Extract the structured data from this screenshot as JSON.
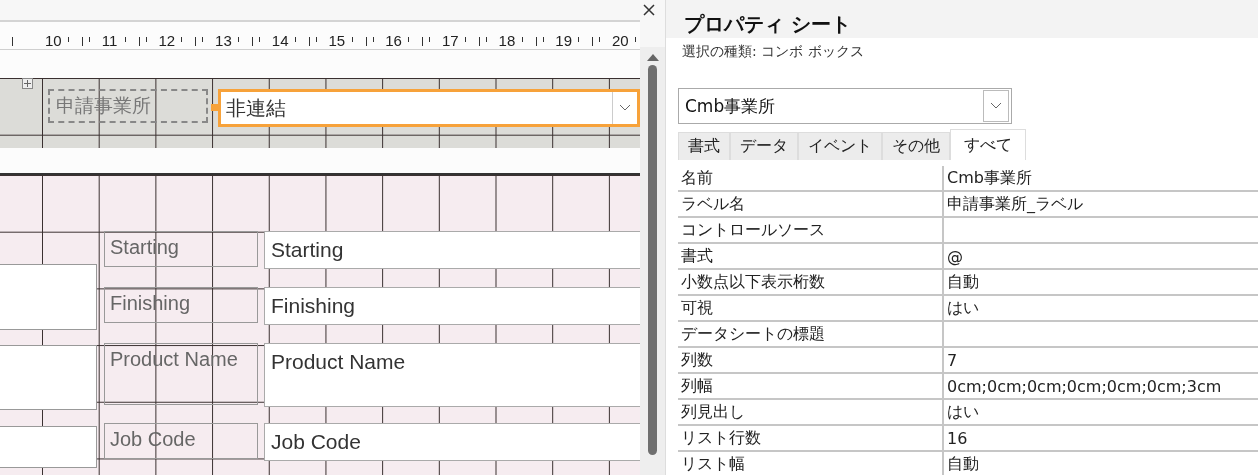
{
  "designer": {
    "ruler": [
      "10",
      "11",
      "12",
      "13",
      "14",
      "15",
      "16",
      "17",
      "18",
      "19",
      "20"
    ],
    "header": {
      "label": "申請事業所",
      "combo": {
        "value": "非連結",
        "selected": true
      }
    },
    "detail": [
      {
        "label": "Starting",
        "textbox": "Starting",
        "tall": false
      },
      {
        "label": "Finishing",
        "textbox": "Finishing",
        "tall": false
      },
      {
        "label": "Product Name",
        "textbox": "Product Name",
        "tall": true
      },
      {
        "label": "Job Code",
        "textbox": "Job Code",
        "tall": false
      }
    ]
  },
  "property_sheet": {
    "title": "プロパティ シート",
    "selection_type": "選択の種類: コンボ ボックス",
    "object": "Cmb事業所",
    "tabs": [
      {
        "label": "書式",
        "selected": false
      },
      {
        "label": "データ",
        "selected": false
      },
      {
        "label": "イベント",
        "selected": false
      },
      {
        "label": "その他",
        "selected": false
      },
      {
        "label": "すべて",
        "selected": true
      }
    ],
    "properties": [
      {
        "name": "名前",
        "value": "Cmb事業所"
      },
      {
        "name": "ラベル名",
        "value": "申請事業所_ラベル"
      },
      {
        "name": "コントロールソース"
      },
      {
        "name": "書式",
        "value": "@"
      },
      {
        "name": "小数点以下表示桁数",
        "value": "自動"
      },
      {
        "name": "可視",
        "value": "はい"
      },
      {
        "name": "データシートの標題"
      },
      {
        "name": "列数",
        "value": "7"
      },
      {
        "name": "列幅",
        "value": "0cm;0cm;0cm;0cm;0cm;0cm;3cm"
      },
      {
        "name": "列見出し",
        "value": "はい"
      },
      {
        "name": "リスト行数",
        "value": "16"
      },
      {
        "name": "リスト幅",
        "value": "自動"
      }
    ]
  }
}
